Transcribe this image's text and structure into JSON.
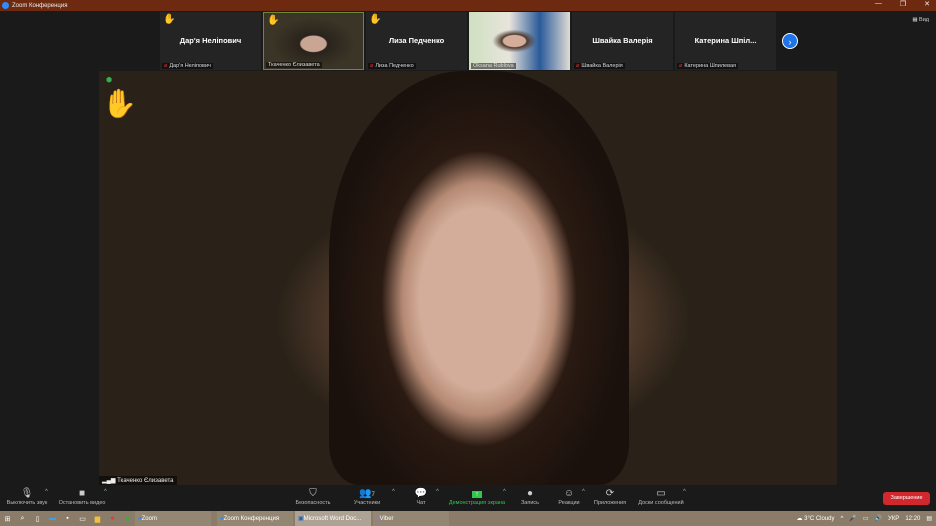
{
  "window": {
    "title": "Zoom Конференция"
  },
  "gallery": {
    "tiles": [
      {
        "display_name": "Дар'я Неліпович",
        "label": "Дар'я Неліпович",
        "muted": true,
        "hand": true,
        "video": false
      },
      {
        "display_name": "",
        "label": "Ткаченко Єлизавета",
        "muted": false,
        "hand": true,
        "video": true
      },
      {
        "display_name": "Лиза Педченко",
        "label": "Лиза Педченко",
        "muted": true,
        "hand": true,
        "video": false
      },
      {
        "display_name": "",
        "label": "Oksana Rublova",
        "muted": false,
        "hand": false,
        "video": true
      },
      {
        "display_name": "Швайка Валерія",
        "label": "Швайка Валерія",
        "muted": true,
        "hand": false,
        "video": false
      },
      {
        "display_name": "Катерина  Шпіл...",
        "label": "Катерина Шпилевая",
        "muted": true,
        "hand": false,
        "video": false
      }
    ],
    "view_label": "Вид"
  },
  "main_video": {
    "speaker": "Ткаченко Єлизавета"
  },
  "toolbar": {
    "mute": "Выключить звук",
    "video": "Остановить видео",
    "security": "Безопасность",
    "participants": "Участники",
    "participants_count": "7",
    "chat": "Чат",
    "share": "Демонстрация экрана",
    "record": "Запись",
    "reactions": "Реакции",
    "apps": "Приложения",
    "whiteboards": "Доски сообщений",
    "end": "Завершение"
  },
  "taskbar": {
    "tasks": [
      "Zoom",
      "Zoom Конференция",
      "Microsoft Word Doc...",
      "Viber"
    ],
    "weather": "3°C  Cloudy",
    "lang": "УКР",
    "time": "12:20"
  }
}
